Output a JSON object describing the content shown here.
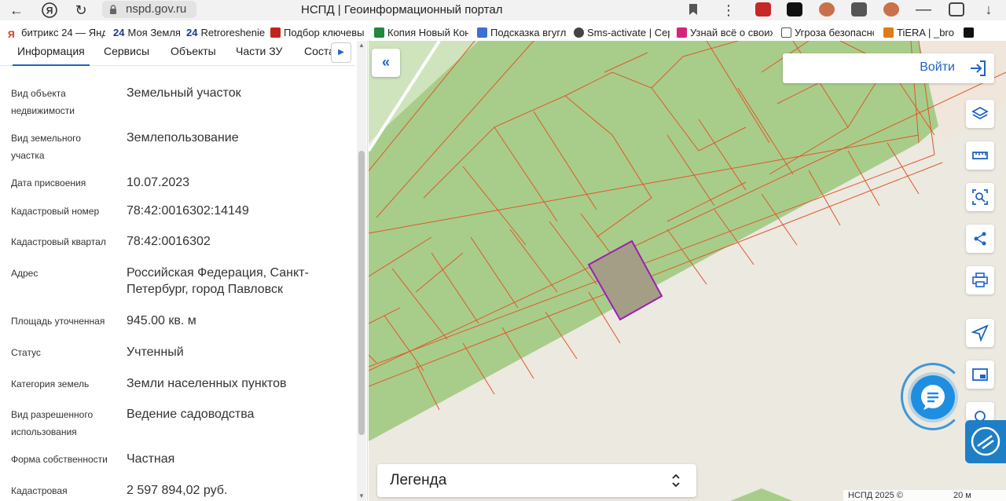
{
  "browser": {
    "url": "nspd.gov.ru",
    "title": "НСПД | Геоинформационный портал"
  },
  "bookmarks": [
    {
      "label": "битрикс 24 — Янд",
      "color": "#d9321f"
    },
    {
      "prefix": "24",
      "label": "Моя Земля",
      "color": "#1a3b8c"
    },
    {
      "prefix": "24",
      "label": "Retroreshenie",
      "color": "#1a3b8c"
    },
    {
      "label": "Подбор ключевы",
      "color": "#c2241c"
    },
    {
      "label": "Копия Новый Кон",
      "color": "#1e8a3a"
    },
    {
      "label": "Подсказка вгугл",
      "color": "#3b6fd4"
    },
    {
      "label": "Sms-activate | Сер",
      "color": "#444444"
    },
    {
      "label": "Узнай всё о своих",
      "color": "#d6247a"
    },
    {
      "label": "Угроза безопасно",
      "color": "#555555"
    },
    {
      "label": "TiERA | _bro",
      "color": "#e07a1a"
    },
    {
      "label": "",
      "color": "#111111"
    }
  ],
  "tabs": [
    {
      "label": "Информация"
    },
    {
      "label": "Сервисы"
    },
    {
      "label": "Объекты"
    },
    {
      "label": "Части ЗУ"
    },
    {
      "label": "Соста"
    }
  ],
  "tab_next_icon": "chevron-right-icon",
  "properties": [
    {
      "key": "Вид объекта недвижимости",
      "value": "Земельный участок"
    },
    {
      "key": "Вид земельного участка",
      "value": "Землепользование"
    },
    {
      "key": "Дата присвоения",
      "value": "10.07.2023"
    },
    {
      "key": "Кадастровый номер",
      "value": "78:42:0016302:14149"
    },
    {
      "key": "Кадастровый квартал",
      "value": "78:42:0016302"
    },
    {
      "key": "Адрес",
      "value": "Российская Федерация, Санкт-Петербург, город Павловск"
    },
    {
      "key": "Площадь уточненная",
      "value": "945.00 кв. м"
    },
    {
      "key": "Статус",
      "value": "Учтенный"
    },
    {
      "key": "Категория земель",
      "value": "Земли населенных пунктов"
    },
    {
      "key": "Вид разрешенного использования",
      "value": "Ведение садоводства"
    },
    {
      "key": "Форма собственности",
      "value": "Частная"
    },
    {
      "key": "Кадастровая",
      "value": "2 597 894,02 руб."
    }
  ],
  "map": {
    "collapse_icon": "double-chevron-left-icon",
    "login_label": "Войти",
    "login_icon": "login-arrow-icon",
    "tools": [
      "layers-icon",
      "ruler-icon",
      "area-select-icon",
      "share-icon",
      "print-icon",
      "navigation-icon",
      "picture-in-picture-icon",
      "map-pin-icon"
    ],
    "chat_icon": "chat-bubble-icon",
    "legend_label": "Легенда",
    "footer_copyright": "НСПД 2025 ©",
    "footer_scale": "20 м",
    "colors": {
      "land": "#9dc67f",
      "parcel_border": "#e0572a",
      "selected_fill": "#a59e86",
      "selected_border": "#9a1fb4",
      "accent": "#1e63c6"
    }
  }
}
